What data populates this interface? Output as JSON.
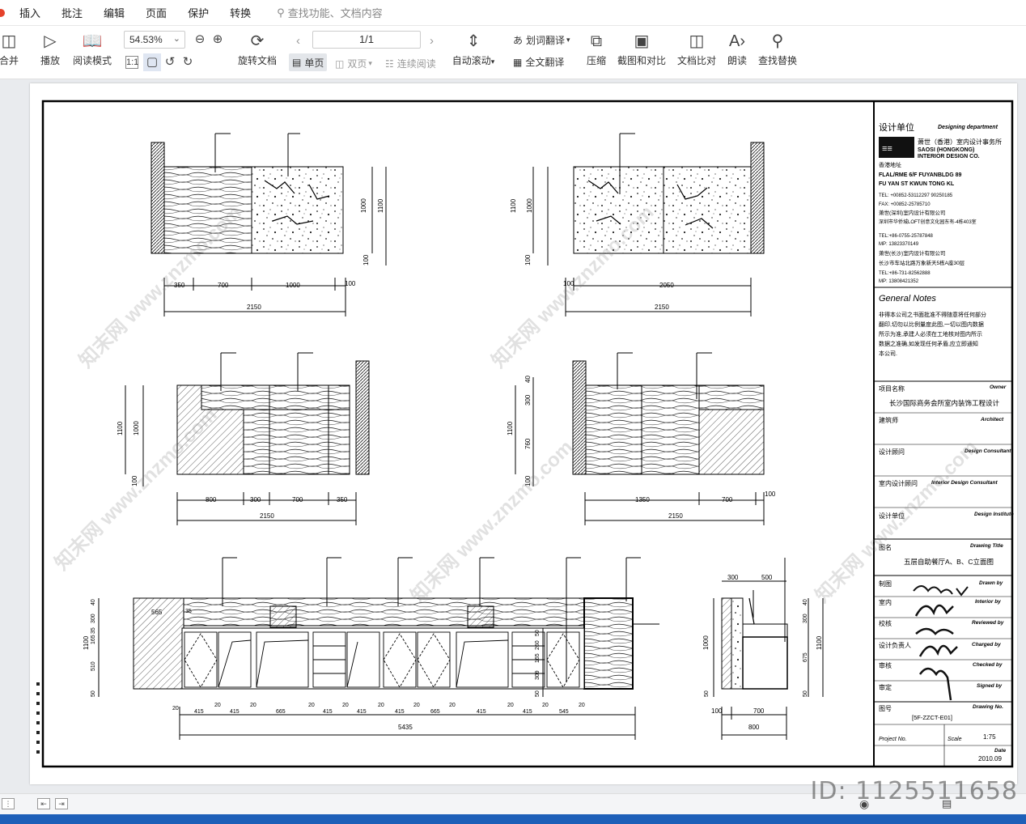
{
  "menu": {
    "items": [
      "插入",
      "批注",
      "编辑",
      "页面",
      "保护",
      "转换"
    ],
    "search_placeholder": "查找功能、文档内容"
  },
  "toolbar": {
    "merge": "合并",
    "play": "播放",
    "read_mode": "阅读模式",
    "zoom": "54.53%",
    "page": "1/1",
    "rotate": "旋转文档",
    "single": "单页",
    "double": "双页",
    "continuous": "连续阅读",
    "auto_scroll": "自动滚动",
    "word_translate": "划词翻译",
    "full_translate": "全文翻译",
    "compress": "压缩",
    "screenshot_compare": "截图和对比",
    "doc_compare": "文档比对",
    "read_aloud": "朗读",
    "find_replace": "查找替换"
  },
  "drawing": {
    "top_left": {
      "dims_top": [
        "350",
        "700",
        "1000",
        "100"
      ],
      "total": "2150",
      "heights": [
        "1000",
        "1100",
        "100"
      ]
    },
    "top_right": {
      "dims_top": [
        "100",
        "2050"
      ],
      "total": "2150",
      "heights": [
        "1100",
        "1000",
        "100"
      ]
    },
    "mid_left": {
      "dims_top": [
        "800",
        "300",
        "700",
        "350"
      ],
      "total": "2150",
      "heights": [
        "1100",
        "1000",
        "100"
      ]
    },
    "mid_right": {
      "dims_top": [
        "1350",
        "700",
        "100"
      ],
      "total": "2150",
      "heights": [
        "40",
        "300",
        "760",
        "1100",
        "100"
      ]
    },
    "bottom_long": {
      "label_565": "565",
      "label_35": "35",
      "dims": [
        "20",
        "415",
        "20",
        "415",
        "20",
        "665",
        "20",
        "415",
        "20",
        "415",
        "20",
        "415",
        "20",
        "665",
        "20",
        "415",
        "20",
        "415",
        "20",
        "545",
        "20"
      ],
      "total": "5435",
      "heights_left": [
        "40",
        "300",
        "35",
        "165",
        "510",
        "50",
        "1100"
      ],
      "heights_mid": [
        "50",
        "260",
        "165",
        "309",
        "50"
      ]
    },
    "bottom_side": {
      "dims_top": [
        "300",
        "500"
      ],
      "dims_bottom": [
        "100",
        "700"
      ],
      "total": "800",
      "heights_left": [
        "1000",
        "50"
      ],
      "heights_right": [
        "40",
        "300",
        "675",
        "1100",
        "50"
      ]
    },
    "title_block": {
      "design_unit": "设计单位",
      "design_unit_en": "Designing department",
      "firm_cn": "萧世（香港）室内设计事务所",
      "firm_en1": "SAOSI (HONGKONG)",
      "firm_en2": "INTERIOR DESIGN CO.",
      "hk_addr_label": "香港地址",
      "addr1": "FLAL/RME 6/F FUYANBLDG 89",
      "addr2": "FU YAN ST KWUN TONG  KL",
      "tel1": "TEL: +00852-53112297 90250185",
      "fax1": "FAX: +00852-25785710",
      "sz_firm": "萧世(深圳)室内设计有限公司",
      "sz_addr": "深圳市华侨城LOFT创意文化园东有-4栋403室",
      "tel2": "TEL:+86-0755-25787848",
      "mp1": "MP: 13823370149",
      "cs_firm": "萧世(长沙)室内设计有限公司",
      "cs_addr": "长沙市车站北路万象新天5栋A座30层",
      "tel3": "TEL:+86-731-82562888",
      "mp2": "MP: 13808421352",
      "notes_title": "General Notes",
      "notes": [
        "非得本公司之书面批准不得随意将任何部分",
        "翻印,切勿以比例量度此图,一切以图内数据",
        "所示为准,承建人必须在工地核对图内所示",
        "数据之准确,如发现任何矛盾,应立即通知",
        "本公司."
      ],
      "project_label": "项目名称",
      "project_en": "Owner",
      "project_name": "长沙国际商务会所室内装饰工程设计",
      "architect_label": "建筑师",
      "architect_en": "Architect",
      "consultant_label": "设计顾问",
      "consultant_en": "Design Consultant",
      "int_consultant_label": "室内设计顾问",
      "int_consultant_en": "Interior Design Consultant",
      "institute_label": "设计单位",
      "institute_en": "Design Institute",
      "drawing_title_label": "图名",
      "drawing_title_en": "Drawing Title",
      "drawing_title": "五层自助餐厅A、B、C立面图",
      "drawn_label": "制图",
      "drawn_en": "Drawn by",
      "interior_label": "室内",
      "interior_en": "Interior by",
      "reviewed_label": "校核",
      "reviewed_en": "Reviewed by",
      "charged_label": "设计负责人",
      "charged_en": "Charged by",
      "checked_label": "审核",
      "checked_en": "Checked by",
      "signed_label": "审定",
      "signed_en": "Signed by",
      "drawing_no_label": "图号",
      "drawing_no_en": "Drawing No.",
      "drawing_no": "[5F-ZZCT-E01]",
      "project_no_en": "Project No.",
      "scale_en": "Scale",
      "scale": "1:75",
      "date_en": "Date",
      "date": "2010.09"
    },
    "watermark": "知末网 www.znzmo.com"
  },
  "id_text": "ID: 1125511658"
}
